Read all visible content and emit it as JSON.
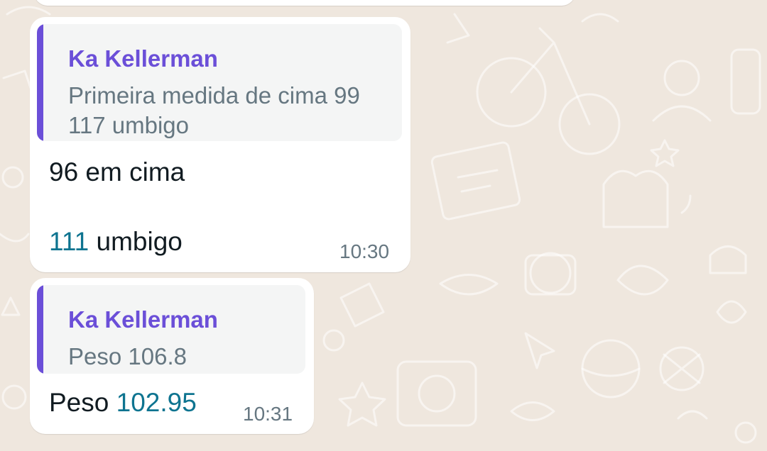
{
  "messages": [
    {
      "quote": {
        "author": "Ka Kellerman",
        "lines": [
          "Primeira medida de cima 99",
          "117 umbigo"
        ]
      },
      "body": {
        "line1": "96 em cima",
        "line2_number": "111",
        "line2_rest": " umbigo"
      },
      "time": "10:30"
    },
    {
      "quote": {
        "author": "Ka Kellerman",
        "lines": [
          "Peso 106.8"
        ]
      },
      "body": {
        "prefix": "Peso ",
        "number": "102.95"
      },
      "time": "10:31"
    }
  ],
  "colors": {
    "wallpaper": "#efe7de",
    "bubble": "#ffffff",
    "quote_accent": "#6b4fd8",
    "quote_background": "#f4f5f5",
    "linked_number": "#0e7490"
  }
}
